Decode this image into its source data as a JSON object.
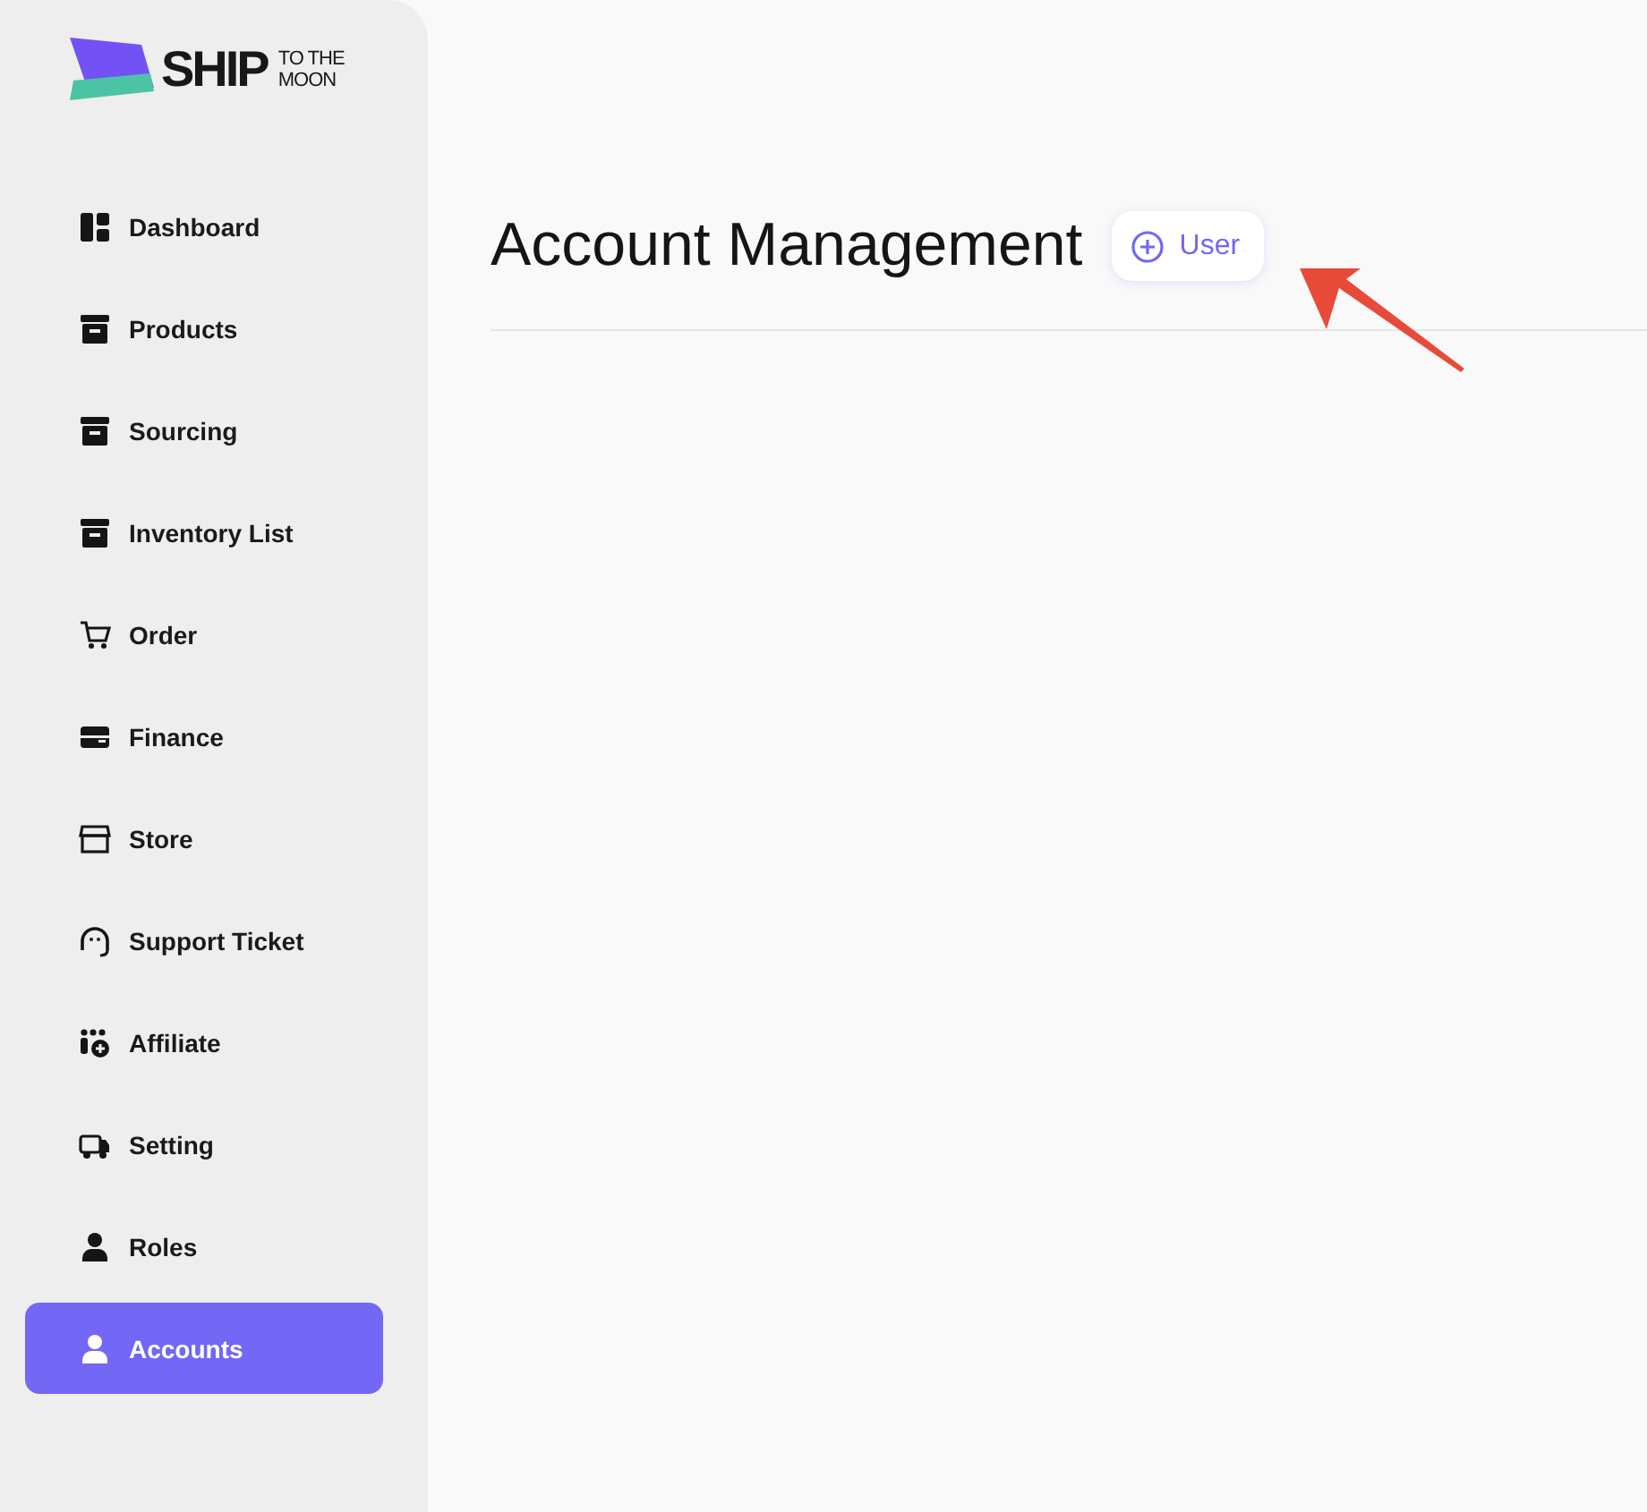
{
  "logo": {
    "main": "SHIP",
    "top": "TO THE",
    "bottom": "MOON"
  },
  "sidebar": {
    "items": [
      {
        "label": "Dashboard",
        "selected": false
      },
      {
        "label": "Products",
        "selected": false
      },
      {
        "label": "Sourcing",
        "selected": false
      },
      {
        "label": "Inventory List",
        "selected": false
      },
      {
        "label": "Order",
        "selected": false
      },
      {
        "label": "Finance",
        "selected": false
      },
      {
        "label": "Store",
        "selected": false
      },
      {
        "label": "Support Ticket",
        "selected": false
      },
      {
        "label": "Affiliate",
        "selected": false
      },
      {
        "label": "Setting",
        "selected": false
      },
      {
        "label": "Roles",
        "selected": false
      },
      {
        "label": "Accounts",
        "selected": true
      }
    ]
  },
  "page": {
    "title": "Account Management",
    "add_button": "User"
  }
}
